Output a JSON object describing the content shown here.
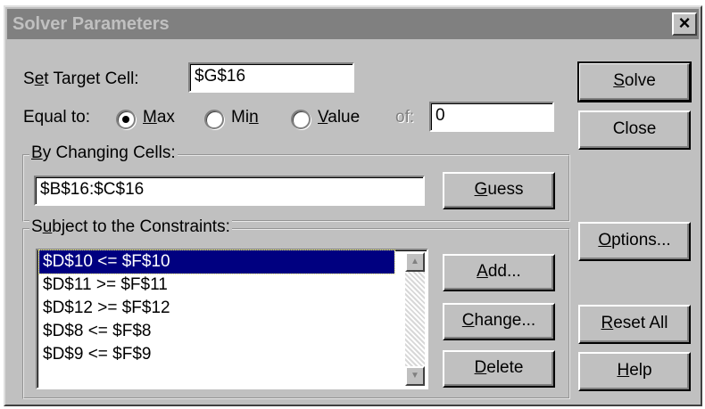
{
  "window": {
    "title": "Solver Parameters",
    "close_glyph": "×"
  },
  "target": {
    "label_pre": "S",
    "label_mn": "e",
    "label_post": "t Target Cell:",
    "value": "$G$16"
  },
  "equal_to": {
    "label": "Equal to:",
    "options": [
      {
        "pre": "",
        "mn": "M",
        "post": "ax",
        "selected": true
      },
      {
        "pre": "Mi",
        "mn": "n",
        "post": "",
        "selected": false
      },
      {
        "pre": "",
        "mn": "V",
        "post": "alue",
        "selected": false
      }
    ],
    "of_label": "of:",
    "value": "0"
  },
  "changing_cells": {
    "label_pre": "",
    "label_mn": "B",
    "label_post": "y Changing Cells:",
    "value": "$B$16:$C$16",
    "guess_pre": "",
    "guess_mn": "G",
    "guess_post": "uess"
  },
  "constraints": {
    "label_pre": "S",
    "label_mn": "u",
    "label_post": "bject to the Constraints:",
    "items": [
      "$D$10 <= $F$10",
      "$D$11 >= $F$11",
      "$D$12 >= $F$12",
      "$D$8 <= $F$8",
      "$D$9 <= $F$9"
    ],
    "selected_index": 0
  },
  "buttons": {
    "solve": {
      "pre": "",
      "mn": "S",
      "post": "olve"
    },
    "close": {
      "label": "Close"
    },
    "options": {
      "pre": "",
      "mn": "O",
      "post": "ptions..."
    },
    "add": {
      "pre": "",
      "mn": "A",
      "post": "dd..."
    },
    "change": {
      "pre": "",
      "mn": "C",
      "post": "hange..."
    },
    "delete": {
      "pre": "",
      "mn": "D",
      "post": "elete"
    },
    "reset_all": {
      "pre": "",
      "mn": "R",
      "post": "eset All"
    },
    "help": {
      "pre": "",
      "mn": "H",
      "post": "elp"
    }
  },
  "colors": {
    "dialog_bg": "#c0c0c0",
    "titlebar_inactive": "#808080",
    "selection": "#000080"
  }
}
